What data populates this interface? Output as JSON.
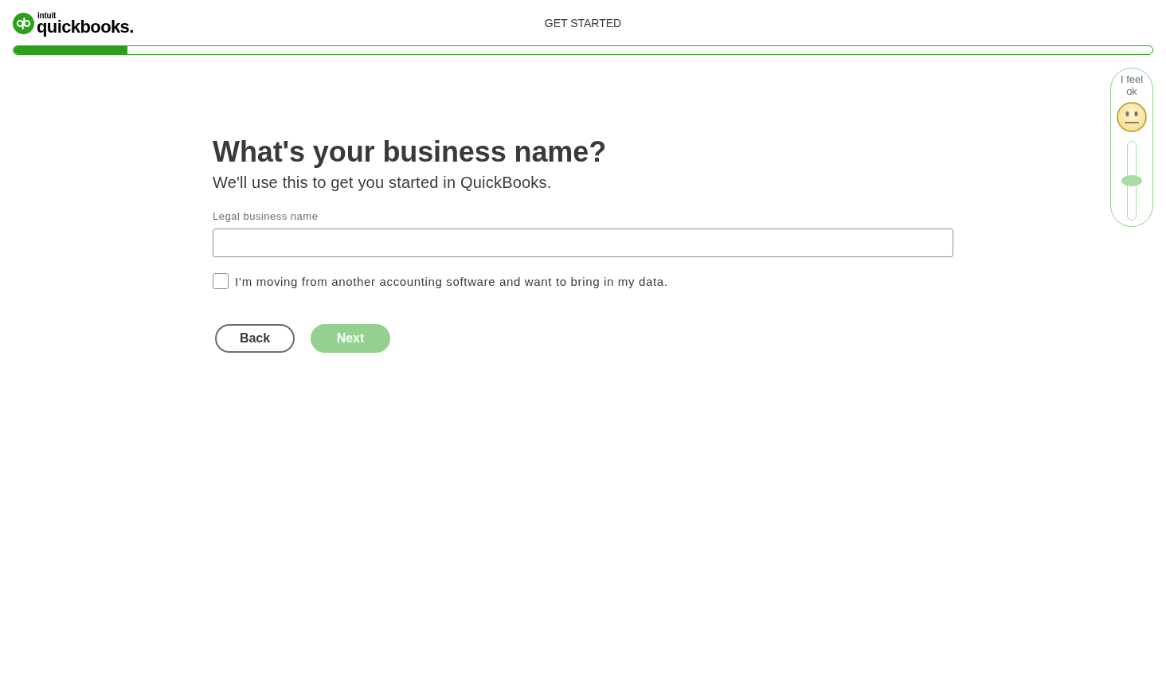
{
  "header": {
    "logo": {
      "brand": "intuit",
      "product": "quickbooks."
    },
    "title": "GET STARTED",
    "progress": {
      "level": 0.1
    }
  },
  "feedback": {
    "label": "I feel ok",
    "mood": {
      "level": 0.5
    }
  },
  "form": {
    "heading": "What's your business name?",
    "subtitle": "We'll use this to get you started in QuickBooks.",
    "field": {
      "label": "Legal business name"
    },
    "checkbox": {
      "label": "I’m moving from another accounting software and want to bring in my data.",
      "checked": false
    },
    "buttons": [
      {
        "label": "Back",
        "kind": "secondary",
        "disabled": false
      },
      {
        "label": "Next",
        "kind": "primary",
        "disabled": true
      }
    ]
  }
}
